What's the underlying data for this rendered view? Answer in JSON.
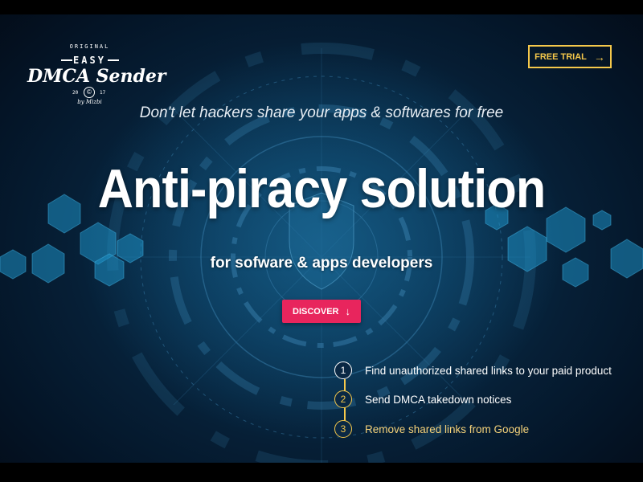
{
  "logo": {
    "original": "ORIGINAL",
    "easy": "EASY",
    "name": "DMCA Sender",
    "year_left": "20",
    "year_right": "17",
    "copyright": "©",
    "by": "by Mizbi"
  },
  "header": {
    "trial_label": "FREE TRIAL",
    "trial_icon": "arrow-right-icon"
  },
  "hero": {
    "tagline": "Don't let hackers share your apps & softwares for free",
    "headline": "Anti-piracy solution",
    "subheadline": "for sofware & apps developers",
    "discover_label": "DISCOVER",
    "discover_icon": "arrow-down-icon"
  },
  "steps": [
    {
      "number": "1",
      "text": "Find unauthorized shared links to your paid product"
    },
    {
      "number": "2",
      "text": "Send DMCA takedown notices"
    },
    {
      "number": "3",
      "text": "Remove shared links from Google"
    }
  ],
  "colors": {
    "accent_yellow": "#f5c84b",
    "discover_pink": "#e8255d",
    "background_navy": "#061f36"
  }
}
